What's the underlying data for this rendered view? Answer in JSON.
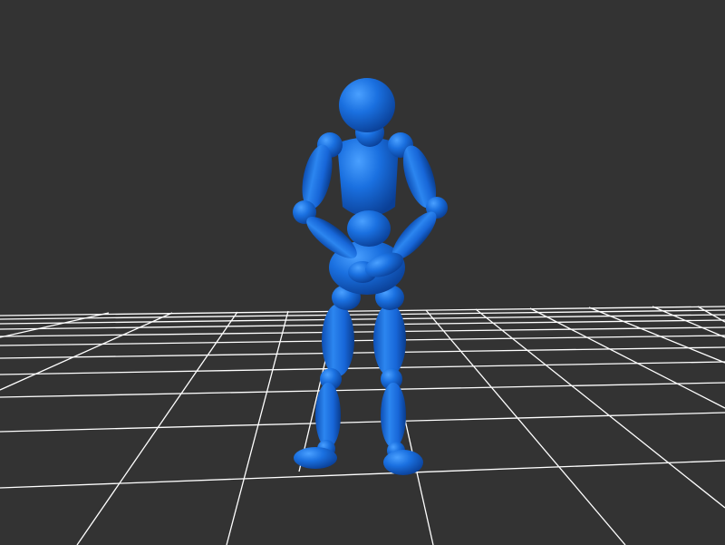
{
  "scene": {
    "background_color": "#333333",
    "grid_color": "#ffffff",
    "figure_color": "#1166dd",
    "figure": "wooden-mannequin",
    "pose": "standing-back-view-hands-clasped-behind",
    "ground": "wireframe-grid-plane"
  }
}
